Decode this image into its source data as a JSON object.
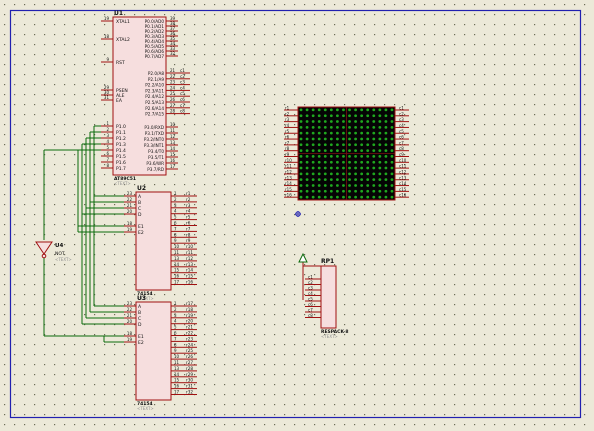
{
  "colors": {
    "background": "#ece9d8",
    "grid_dot": "#6b6b55",
    "border": "#2020b0",
    "chip_fill": "#f6dede",
    "chip_border": "#a01010",
    "pin_line": "#a01010",
    "wire": "#0a6a0a",
    "matrix_bg": "#050505",
    "matrix_led": "#1fa81f",
    "label": "#101010",
    "text_placeholder": "#909090"
  },
  "u1": {
    "ref": "U1",
    "left_pins_top": [
      "XTAL1",
      "XTAL2",
      "RST"
    ],
    "left_pin_nums_top": [
      "19",
      "18",
      "9"
    ],
    "left_pins_mid": [
      "PSEN",
      "ALE",
      "EA"
    ],
    "left_pin_nums_mid": [
      "29",
      "30",
      "31"
    ],
    "left_pins_p1": [
      "P1.0",
      "P1.1",
      "P1.2",
      "P1.3",
      "P1.4",
      "P1.5",
      "P1.6",
      "P1.7"
    ],
    "left_pin_nums_p1": [
      "1",
      "2",
      "3",
      "4",
      "5",
      "6",
      "7",
      "8"
    ],
    "right_p0": [
      "P0.0/AD0",
      "P0.1/AD1",
      "P0.2/AD2",
      "P0.3/AD3",
      "P0.4/AD4",
      "P0.5/AD5",
      "P0.6/AD6",
      "P0.7/AD7"
    ],
    "right_p0_nums": [
      "39",
      "38",
      "37",
      "36",
      "35",
      "34",
      "33",
      "32"
    ],
    "right_p2": [
      "P2.0/A8",
      "P2.1/A9",
      "P2.2/A10",
      "P2.3/A11",
      "P2.4/A12",
      "P2.5/A13",
      "P2.6/A14",
      "P2.7/A15"
    ],
    "right_p2_nums": [
      "21",
      "22",
      "23",
      "24",
      "25",
      "26",
      "27",
      "28"
    ],
    "right_p3": [
      "P3.0/RXD",
      "P3.1/TXD",
      "P3.2/INT0",
      "P3.3/INT1",
      "P3.4/T0",
      "P3.5/T1",
      "P3.6/WR",
      "P3.7/RD"
    ],
    "right_p3_nums": [
      "10",
      "11",
      "12",
      "13",
      "14",
      "15",
      "16",
      "17"
    ],
    "right_net_labels": [
      "c1",
      "c2",
      "c3",
      "c4",
      "c5",
      "c6",
      "c7",
      "c8"
    ],
    "part": "AT89C51",
    "text": "<TEXT>"
  },
  "u2": {
    "ref": "U2",
    "left_pins": [
      "A",
      "B",
      "C",
      "D",
      "E1",
      "E2"
    ],
    "left_nums": [
      "23",
      "22",
      "21",
      "20",
      "18",
      "19"
    ],
    "right_pins": [
      "0",
      "1",
      "2",
      "3",
      "4",
      "5",
      "6",
      "7",
      "8",
      "9",
      "10",
      "11",
      "12",
      "13",
      "14",
      "15"
    ],
    "right_nums": [
      "1",
      "2",
      "3",
      "4",
      "5",
      "6",
      "7",
      "8",
      "9",
      "10",
      "11",
      "13",
      "14",
      "15",
      "16",
      "17"
    ],
    "net_labels": [
      "r1",
      "r2",
      "r3",
      "r4",
      "r5",
      "r6",
      "r7",
      "r8",
      "r9",
      "r10",
      "r11",
      "r12",
      "r13",
      "r14",
      "r15",
      "r16"
    ],
    "part": "74154",
    "text": "<TEXT>"
  },
  "u3": {
    "ref": "U3",
    "left_pins": [
      "A",
      "B",
      "C",
      "D",
      "E1",
      "E2"
    ],
    "left_nums": [
      "23",
      "22",
      "21",
      "20",
      "18",
      "19"
    ],
    "right_pins": [
      "0",
      "1",
      "2",
      "3",
      "4",
      "5",
      "6",
      "7",
      "8",
      "9",
      "10",
      "11",
      "12",
      "13",
      "14",
      "15"
    ],
    "right_nums": [
      "1",
      "2",
      "3",
      "4",
      "5",
      "6",
      "7",
      "8",
      "9",
      "10",
      "11",
      "13",
      "14",
      "15",
      "16",
      "17"
    ],
    "net_labels": [
      "r17",
      "r18",
      "r19",
      "r20",
      "r21",
      "r22",
      "r23",
      "r24",
      "r25",
      "r26",
      "r27",
      "r28",
      "r29",
      "r30",
      "r31",
      "r32"
    ],
    "part": "74154",
    "text": "<TEXT>"
  },
  "u4": {
    "ref": "U4",
    "part": "NOT",
    "text": "<TEXT>"
  },
  "matrix": {
    "rows": 16,
    "cols": 16,
    "left_labels": [
      "r1",
      "r2",
      "r3",
      "r4",
      "r5",
      "r6",
      "r7",
      "r8",
      "r9",
      "r10",
      "r11",
      "r12",
      "r13",
      "r14",
      "r15",
      "r16"
    ],
    "right_labels": [
      "c1",
      "c2",
      "c3",
      "c4",
      "c5",
      "c6",
      "c7",
      "c8",
      "c9",
      "c10",
      "c11",
      "c12",
      "c13",
      "c14",
      "c15",
      "c16"
    ]
  },
  "rp1": {
    "ref": "RP1",
    "part": "RESPACK-8",
    "text": "<TEXT>",
    "pin_labels": [
      "c1",
      "c2",
      "c3",
      "c4",
      "c5",
      "c6",
      "c7",
      "c8"
    ]
  }
}
